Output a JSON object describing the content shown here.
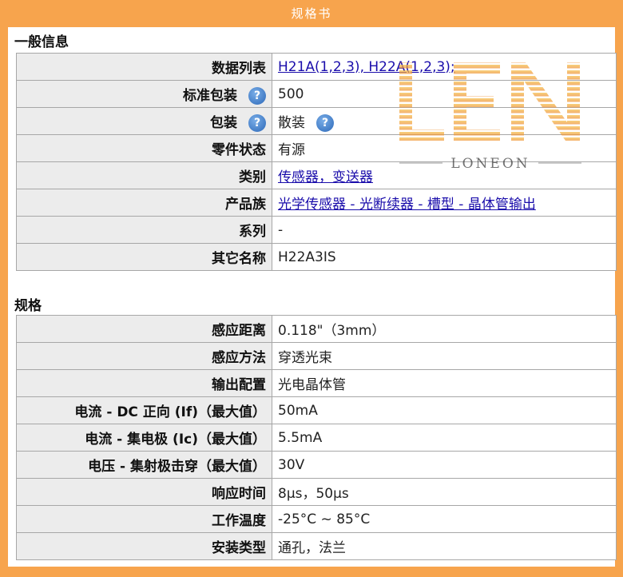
{
  "header": {
    "title": "规格书"
  },
  "general": {
    "title": "一般信息",
    "rows": [
      {
        "label": "数据列表",
        "value": "H21A(1,2,3), H22A(1,2,3);",
        "link": true,
        "help": false,
        "value_help": false
      },
      {
        "label": "标准包装",
        "value": "500",
        "link": false,
        "help": true,
        "value_help": false
      },
      {
        "label": "包装",
        "value": "散装",
        "link": false,
        "help": true,
        "value_help": true
      },
      {
        "label": "零件状态",
        "value": "有源",
        "link": false,
        "help": false,
        "value_help": false
      },
      {
        "label": "类别",
        "value": "传感器，变送器",
        "link": true,
        "help": false,
        "value_help": false
      },
      {
        "label": "产品族",
        "value": "光学传感器 - 光断续器 - 槽型 - 晶体管输出",
        "link": true,
        "help": false,
        "value_help": false
      },
      {
        "label": "系列",
        "value": "-",
        "link": false,
        "help": false,
        "value_help": false
      },
      {
        "label": "其它名称",
        "value": "H22A3IS",
        "link": false,
        "help": false,
        "value_help": false
      }
    ]
  },
  "specs": {
    "title": "规格",
    "rows": [
      {
        "label": "感应距离",
        "value": "0.118\"（3mm）"
      },
      {
        "label": "感应方法",
        "value": "穿透光束"
      },
      {
        "label": "输出配置",
        "value": "光电晶体管"
      },
      {
        "label": "电流 - DC 正向 (If)（最大值）",
        "value": "50mA"
      },
      {
        "label": "电流 - 集电极 (Ic)（最大值）",
        "value": "5.5mA"
      },
      {
        "label": "电压 - 集射极击穿（最大值）",
        "value": "30V"
      },
      {
        "label": "响应时间",
        "value": "8μs，50μs"
      },
      {
        "label": "工作温度",
        "value": "-25°C ~ 85°C"
      },
      {
        "label": "安装类型",
        "value": "通孔，法兰"
      }
    ]
  },
  "help_icon": {
    "name": "help-question-icon",
    "glyph": "?"
  },
  "watermark": {
    "logo": "LEN",
    "brand": "LONEON"
  },
  "colors": {
    "background": "#f7a44d",
    "label_cell": "#ececec",
    "link": "#1a0dab",
    "border": "#a7a7a7"
  }
}
